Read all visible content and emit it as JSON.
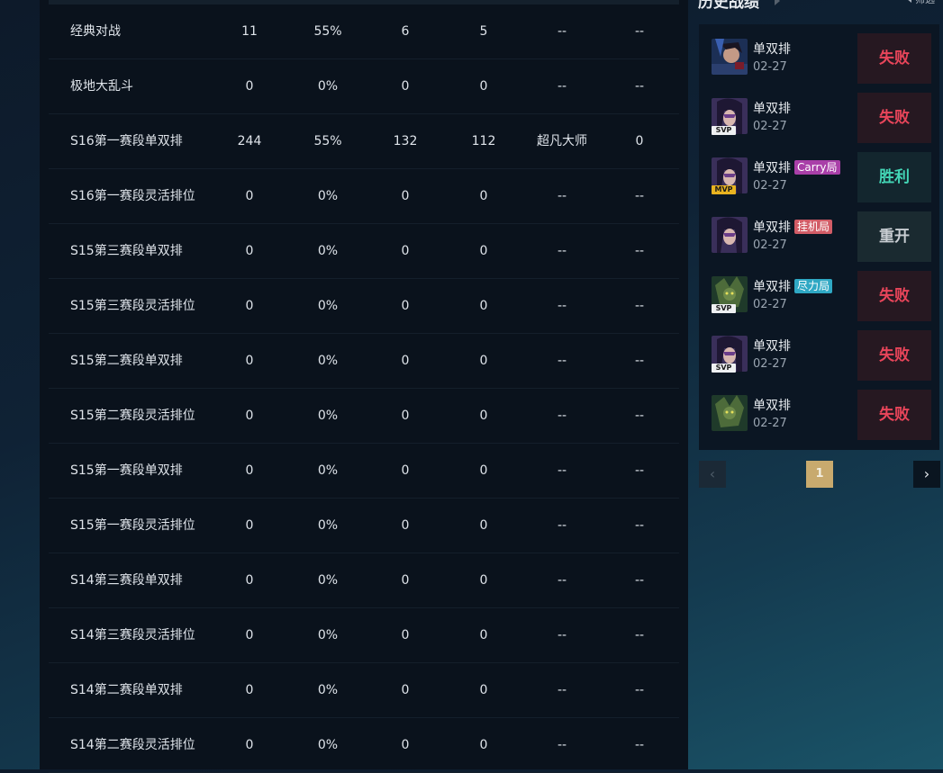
{
  "stats_rows": [
    {
      "name": "经典对战",
      "games": "11",
      "winrate": "55%",
      "wins": "6",
      "losses": "5",
      "tier": "--",
      "points": "--"
    },
    {
      "name": "极地大乱斗",
      "games": "0",
      "winrate": "0%",
      "wins": "0",
      "losses": "0",
      "tier": "--",
      "points": "--"
    },
    {
      "name": "S16第一赛段单双排",
      "games": "244",
      "winrate": "55%",
      "wins": "132",
      "losses": "112",
      "tier": "超凡大师",
      "points": "0"
    },
    {
      "name": "S16第一赛段灵活排位",
      "games": "0",
      "winrate": "0%",
      "wins": "0",
      "losses": "0",
      "tier": "--",
      "points": "--"
    },
    {
      "name": "S15第三赛段单双排",
      "games": "0",
      "winrate": "0%",
      "wins": "0",
      "losses": "0",
      "tier": "--",
      "points": "--"
    },
    {
      "name": "S15第三赛段灵活排位",
      "games": "0",
      "winrate": "0%",
      "wins": "0",
      "losses": "0",
      "tier": "--",
      "points": "--"
    },
    {
      "name": "S15第二赛段单双排",
      "games": "0",
      "winrate": "0%",
      "wins": "0",
      "losses": "0",
      "tier": "--",
      "points": "--"
    },
    {
      "name": "S15第二赛段灵活排位",
      "games": "0",
      "winrate": "0%",
      "wins": "0",
      "losses": "0",
      "tier": "--",
      "points": "--"
    },
    {
      "name": "S15第一赛段单双排",
      "games": "0",
      "winrate": "0%",
      "wins": "0",
      "losses": "0",
      "tier": "--",
      "points": "--"
    },
    {
      "name": "S15第一赛段灵活排位",
      "games": "0",
      "winrate": "0%",
      "wins": "0",
      "losses": "0",
      "tier": "--",
      "points": "--"
    },
    {
      "name": "S14第三赛段单双排",
      "games": "0",
      "winrate": "0%",
      "wins": "0",
      "losses": "0",
      "tier": "--",
      "points": "--"
    },
    {
      "name": "S14第三赛段灵活排位",
      "games": "0",
      "winrate": "0%",
      "wins": "0",
      "losses": "0",
      "tier": "--",
      "points": "--"
    },
    {
      "name": "S14第二赛段单双排",
      "games": "0",
      "winrate": "0%",
      "wins": "0",
      "losses": "0",
      "tier": "--",
      "points": "--"
    },
    {
      "name": "S14第二赛段灵活排位",
      "games": "0",
      "winrate": "0%",
      "wins": "0",
      "losses": "0",
      "tier": "--",
      "points": "--"
    }
  ],
  "history": {
    "title": "历史战绩",
    "filter_label": "筛选",
    "matches": [
      {
        "mode": "单双排",
        "date": "02-27",
        "result": "失败",
        "badge": "",
        "chip": "",
        "avatar": "avatar-a"
      },
      {
        "mode": "单双排",
        "date": "02-27",
        "result": "失败",
        "badge": "SVP",
        "chip": "",
        "avatar": "avatar-b"
      },
      {
        "mode": "单双排",
        "date": "02-27",
        "result": "胜利",
        "badge": "MVP",
        "chip": "Carry局",
        "avatar": "avatar-b"
      },
      {
        "mode": "单双排",
        "date": "02-27",
        "result": "重开",
        "badge": "",
        "chip": "挂机局",
        "avatar": "avatar-b"
      },
      {
        "mode": "单双排",
        "date": "02-27",
        "result": "失败",
        "badge": "SVP",
        "chip": "尽力局",
        "avatar": "avatar-c"
      },
      {
        "mode": "单双排",
        "date": "02-27",
        "result": "失败",
        "badge": "SVP",
        "chip": "",
        "avatar": "avatar-b"
      },
      {
        "mode": "单双排",
        "date": "02-27",
        "result": "失败",
        "badge": "",
        "chip": "",
        "avatar": "avatar-c"
      }
    ]
  },
  "pagination": {
    "prev": "‹",
    "page": "1",
    "next": "›"
  }
}
